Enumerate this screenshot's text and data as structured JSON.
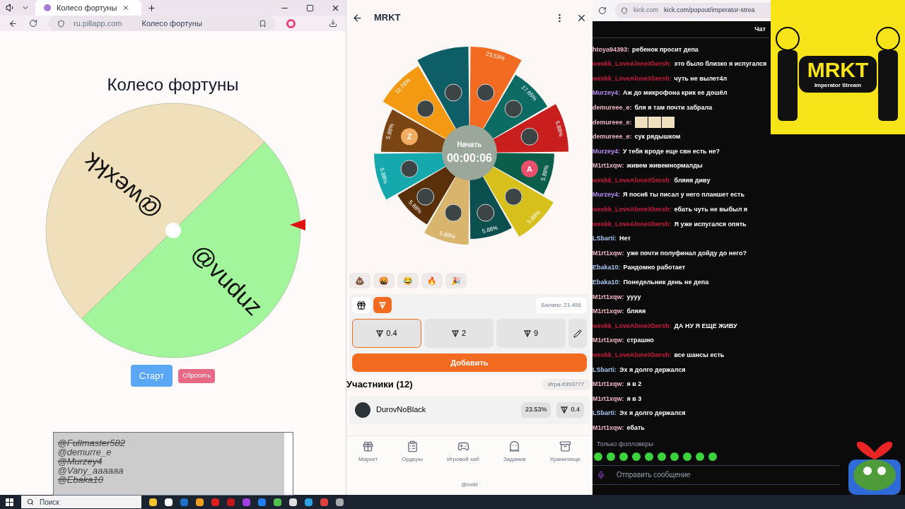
{
  "browser": {
    "tab": {
      "title": "Колесо фортуны",
      "selected": true
    },
    "address": "ru.pillapp.com",
    "page_title": "Колесо фортуны"
  },
  "fortune_page": {
    "heading": "Колесо фортуны",
    "wheel": [
      {
        "name": "@wexkk",
        "color": "#f0dfbb"
      },
      {
        "name": "@vuduz",
        "color": "#a3f59b"
      }
    ],
    "start_button": "Старт",
    "reset_button": "Сбросить",
    "names_list": [
      {
        "text": "@Fullmaster582",
        "struck": true
      },
      {
        "text": "@demurre_e",
        "struck": false
      },
      {
        "text": "@Murzey4",
        "struck": true
      },
      {
        "text": "@Vany_aaaaaa",
        "struck": false
      },
      {
        "text": "@Ebaka10",
        "struck": true
      }
    ]
  },
  "mrkt": {
    "title": "MRKT",
    "wheel_center": {
      "label": "Начать",
      "timer": "00:00:06"
    },
    "segments": [
      {
        "color": "#f26b21",
        "label": "23.53%",
        "avatar": {
          "kind": "photo"
        }
      },
      {
        "color": "#0c6b63",
        "label": "17.65%",
        "avatar": {
          "kind": "photo"
        }
      },
      {
        "color": "#c81e1e",
        "label": "5.88%",
        "avatar": {
          "kind": "photo"
        }
      },
      {
        "color": "#0b5e4a",
        "label": "5.88%",
        "avatar": {
          "kind": "letter",
          "letter": "A",
          "color": "#ea4f6b"
        }
      },
      {
        "color": "#d8c01c",
        "label": "5.88%",
        "avatar": {
          "kind": "photo"
        }
      },
      {
        "color": "#0b4f4f",
        "label": "5.88%",
        "avatar": {
          "kind": "photo"
        }
      },
      {
        "color": "#d8b46c",
        "label": "5.88%",
        "avatar": {
          "kind": "photo"
        }
      },
      {
        "color": "#5a300a",
        "label": "5.88%",
        "avatar": {
          "kind": "photo"
        }
      },
      {
        "color": "#15a9ae",
        "label": "5.88%",
        "avatar": {
          "kind": "photo"
        }
      },
      {
        "color": "#7a4512",
        "label": "5.88%",
        "avatar": {
          "kind": "letter",
          "letter": "Z",
          "color": "#f2ac60"
        }
      },
      {
        "color": "#f49a12",
        "label": "11.76%",
        "avatar": {
          "kind": "photo"
        }
      },
      {
        "color": "#0d5e66",
        "avatar": {
          "kind": "photo"
        }
      }
    ],
    "reactions": [
      "💩",
      "🤬",
      "😂",
      "🔥",
      "🎉"
    ],
    "currency_tabs": [
      {
        "kind": "gift",
        "selected": false
      },
      {
        "kind": "ton",
        "selected": true
      }
    ],
    "balance": "Баланс: 21.456",
    "amounts": [
      {
        "value": "0.4",
        "selected": true
      },
      {
        "value": "2",
        "selected": false
      },
      {
        "value": "9",
        "selected": false
      }
    ],
    "add_button": "Добавить",
    "participants_title": "Участники (12)",
    "game_id": "Игра #393777",
    "participants": [
      {
        "name": "DurovNoBlack",
        "share": "23.53%",
        "bet": "0.4"
      }
    ],
    "nav": [
      {
        "kind": "gift",
        "label": "Маркет"
      },
      {
        "kind": "orders",
        "label": "Ордеры"
      },
      {
        "kind": "games",
        "label": "Игровой хаб"
      },
      {
        "kind": "tasks",
        "label": "Задания"
      },
      {
        "kind": "storage",
        "label": "Хранилище"
      }
    ],
    "footer": "@mrkt"
  },
  "chat": {
    "site": "kick.com",
    "url": "kick.com/popout/imperator-strea",
    "title": "Чат",
    "messages": [
      {
        "kind": "text",
        "user": "htoya94393:",
        "color": "#f2b8c6",
        "text": "ребенок просит депа"
      },
      {
        "kind": "text",
        "user": "wexkk_LoveAloneXbersh:",
        "color": "#c8183e",
        "text": "это было близко я испугался"
      },
      {
        "kind": "text",
        "user": "wexkk_LoveAloneXbersh:",
        "color": "#c8183e",
        "text": "чуть не вылет4л"
      },
      {
        "kind": "text",
        "user": "Murzey4:",
        "color": "#b98cf2",
        "text": "Аж до микрофона крик ее дошёл"
      },
      {
        "kind": "text",
        "user": "demureee_e:",
        "color": "#f2b8c6",
        "text": "бля я там почти забрала"
      },
      {
        "kind": "emotes",
        "user": "demureee_e:",
        "color": "#f2b8c6"
      },
      {
        "kind": "text",
        "user": "demureee_e:",
        "color": "#f2b8c6",
        "text": "сук рядышком"
      },
      {
        "kind": "text",
        "user": "Murzey4:",
        "color": "#b98cf2",
        "text": "У тебя вроде еще свн есть не?"
      },
      {
        "kind": "text",
        "user": "M1rt1xqw:",
        "color": "#f2b8c6",
        "text": "живем живемнормалды"
      },
      {
        "kind": "text",
        "user": "wexkk_LoveAloneXbersh:",
        "color": "#c8183e",
        "text": "бляяя диву"
      },
      {
        "kind": "text",
        "user": "Murzey4:",
        "color": "#b98cf2",
        "text": "Я посн6 ты писал у него планшет есть"
      },
      {
        "kind": "text",
        "user": "wexkk_LoveAloneXbersh:",
        "color": "#c8183e",
        "text": "ебать чуть не выбыл я"
      },
      {
        "kind": "text",
        "user": "wexkk_LoveAloneXbersh:",
        "color": "#c8183e",
        "text": "Я уже испугался опять"
      },
      {
        "kind": "text",
        "user": "LSbarti:",
        "color": "#a7c7f2",
        "text": "Нет"
      },
      {
        "kind": "text",
        "user": "M1rt1xqw:",
        "color": "#f2b8c6",
        "text": "уже почти полуфинал дойду до него?"
      },
      {
        "kind": "text",
        "user": "Ebaka10:",
        "color": "#a7c7f2",
        "text": "Рандомно работает"
      },
      {
        "kind": "text",
        "user": "Ebaka10:",
        "color": "#a7c7f2",
        "text": "Понедельник день не депа"
      },
      {
        "kind": "text",
        "user": "M1rt1xqw:",
        "color": "#f2b8c6",
        "text": "уууу"
      },
      {
        "kind": "text",
        "user": "M1rt1xqw:",
        "color": "#f2b8c6",
        "text": "бляяя"
      },
      {
        "kind": "text",
        "user": "wexkk_LoveAloneXbersh:",
        "color": "#c8183e",
        "text": "ДА НУ Я ЕЩЕ ЖИВУ"
      },
      {
        "kind": "text",
        "user": "M1rt1xqw:",
        "color": "#f2b8c6",
        "text": "страшно"
      },
      {
        "kind": "text",
        "user": "wexkk_LoveAloneXbersh:",
        "color": "#c8183e",
        "text": "все шансы есть"
      },
      {
        "kind": "text",
        "user": "LSbarti:",
        "color": "#a7c7f2",
        "text": "Эх я долго держался"
      },
      {
        "kind": "text",
        "user": "M1rt1xqw:",
        "color": "#f2b8c6",
        "text": "я в 2"
      },
      {
        "kind": "text",
        "user": "M1rt1xqw:",
        "color": "#f2b8c6",
        "text": "я в 3"
      },
      {
        "kind": "text",
        "user": "LSbarti:",
        "color": "#a7c7f2",
        "text": "Эх я долго держался"
      },
      {
        "kind": "text",
        "user": "M1rt1xqw:",
        "color": "#f2b8c6",
        "text": "ебать"
      }
    ],
    "mode": "Только фолловеры",
    "input_placeholder": "Отправить сообщение"
  },
  "overlay": {
    "logo": "MRKT",
    "subtitle": "Imperator Stream"
  },
  "taskbar": {
    "search_placeholder": "Поиск"
  }
}
